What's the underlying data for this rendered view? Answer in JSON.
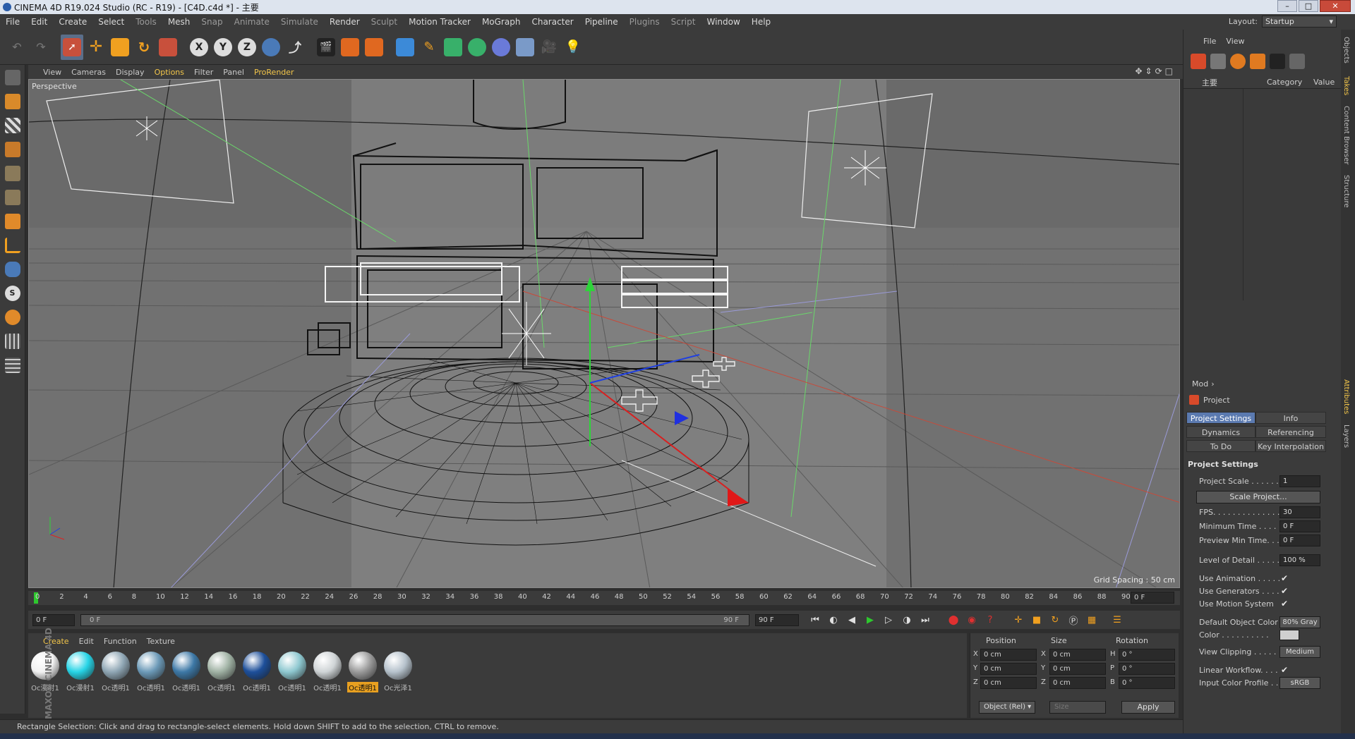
{
  "window": {
    "title": "CINEMA 4D R19.024 Studio (RC - R19) - [C4D.c4d *] - 主要"
  },
  "menu": [
    "File",
    "Edit",
    "Create",
    "Select",
    "Tools",
    "Mesh",
    "Snap",
    "Animate",
    "Simulate",
    "Render",
    "Sculpt",
    "Motion Tracker",
    "MoGraph",
    "Character",
    "Pipeline",
    "Plugins",
    "Script",
    "Window",
    "Help"
  ],
  "layout": {
    "label": "Layout:",
    "value": "Startup"
  },
  "viewport_menu": [
    "View",
    "Cameras",
    "Display",
    "Options",
    "Filter",
    "Panel",
    "ProRender"
  ],
  "viewport": {
    "label": "Perspective",
    "grid_spacing": "Grid Spacing : 50 cm"
  },
  "timeline": {
    "ticks": [
      "0",
      "2",
      "4",
      "6",
      "8",
      "10",
      "12",
      "14",
      "16",
      "18",
      "20",
      "22",
      "24",
      "26",
      "28",
      "30",
      "32",
      "34",
      "36",
      "38",
      "40",
      "42",
      "44",
      "46",
      "48",
      "50",
      "52",
      "54",
      "56",
      "58",
      "60",
      "62",
      "64",
      "66",
      "68",
      "70",
      "72",
      "74",
      "76",
      "78",
      "80",
      "82",
      "84",
      "86",
      "88",
      "90"
    ],
    "current": "0 F"
  },
  "transport": {
    "start": "0 F",
    "scrub_start": "0 F",
    "scrub_end": "90 F",
    "end": "90 F"
  },
  "material_menu": [
    "Create",
    "Edit",
    "Function",
    "Texture"
  ],
  "materials": [
    {
      "label": "Oc漫射1",
      "color": "#f2f2f2"
    },
    {
      "label": "Oc漫射1",
      "color": "#26d4e6"
    },
    {
      "label": "Oc透明1",
      "color": "#8fa6b4"
    },
    {
      "label": "Oc透明1",
      "color": "#6c9ab8"
    },
    {
      "label": "Oc透明1",
      "color": "#3d78a6"
    },
    {
      "label": "Oc透明1",
      "color": "#a0b2a4"
    },
    {
      "label": "Oc透明1",
      "color": "#1d4f9a"
    },
    {
      "label": "Oc透明1",
      "color": "#8ec8d0"
    },
    {
      "label": "Oc透明1",
      "color": "#cfd4d6"
    },
    {
      "label": "Oc透明1",
      "color": "#9a9a9a"
    },
    {
      "label": "Oc光泽1",
      "color": "#b6c2cc"
    }
  ],
  "coords": {
    "headers": [
      "Position",
      "Size",
      "Rotation"
    ],
    "rows": [
      {
        "axis": "X",
        "pos": "0 cm",
        "size_axis": "X",
        "size": "0 cm",
        "rot_axis": "H",
        "rot": "0 °"
      },
      {
        "axis": "Y",
        "pos": "0 cm",
        "size_axis": "Y",
        "size": "0 cm",
        "rot_axis": "P",
        "rot": "0 °"
      },
      {
        "axis": "Z",
        "pos": "0 cm",
        "size_axis": "Z",
        "size": "0 cm",
        "rot_axis": "B",
        "rot": "0 °"
      }
    ],
    "mode": "Object (Rel)",
    "size_mode": "Size",
    "apply": "Apply"
  },
  "status": "Rectangle Selection: Click and drag to rectangle-select elements. Hold down SHIFT to add to the selection, CTRL to remove.",
  "object_manager": {
    "menu": [
      "File",
      "View"
    ],
    "columns": [
      "主要",
      "Category",
      "Value"
    ]
  },
  "attributes": {
    "menu": "Mod",
    "title": "Project",
    "tabs": [
      "Project Settings",
      "Info",
      "Dynamics",
      "Referencing",
      "To Do",
      "Key Interpolation"
    ],
    "section": "Project Settings",
    "rows": [
      {
        "label": "Project Scale . . . . . .",
        "value": "1"
      },
      {
        "label": "FPS. . . . . . . . . . . . . . .",
        "value": "30"
      },
      {
        "label": "Minimum Time . . . . .",
        "value": "0 F"
      },
      {
        "label": "Preview Min Time. . .",
        "value": "0 F"
      },
      {
        "label": "Level of Detail . . . . .",
        "value": "100 %"
      },
      {
        "label": "Use Animation . . . . .",
        "value": "✔"
      },
      {
        "label": "Use Generators . . . .",
        "value": "✔"
      },
      {
        "label": "Use Motion System",
        "value": "✔"
      },
      {
        "label": "Default Object Color",
        "value": "80% Gray"
      },
      {
        "label": "Color . . . . . . . . . .",
        "value": ""
      },
      {
        "label": "View Clipping . . . . .",
        "value": "Medium"
      },
      {
        "label": "Linear Workflow. . . .",
        "value": "✔"
      },
      {
        "label": "Input Color Profile . .",
        "value": "sRGB"
      }
    ],
    "scale_button": "Scale Project..."
  },
  "right_tabs": [
    "Objects",
    "Takes",
    "Content Browser",
    "Structure",
    "Attributes",
    "Layers"
  ],
  "brand": "MAXON CINEMA 4D",
  "colors": {
    "accent": "#f3c64a",
    "selected_tab": "#5b7ab0",
    "viewport_bg": "#6b6b6b"
  }
}
